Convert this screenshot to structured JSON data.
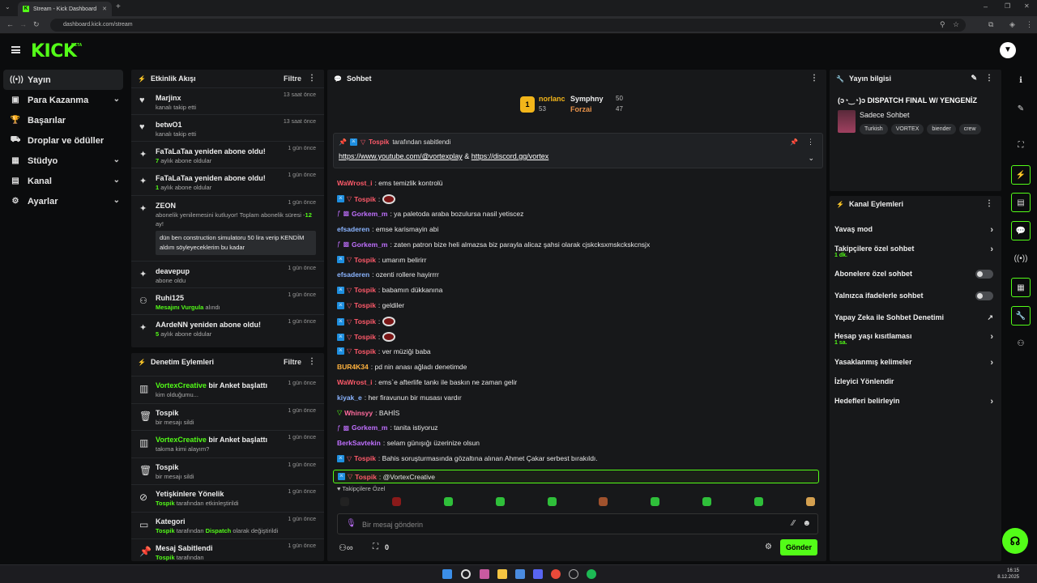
{
  "browser": {
    "tab_title": "Stream - Kick Dashboard",
    "url": "dashboard.kick.com/stream"
  },
  "brand": {
    "logo": "KICK",
    "beta": "BETA",
    "accent": "#53fc18"
  },
  "left_nav": [
    {
      "label": "Yayın",
      "icon": "broadcast-icon",
      "active": true
    },
    {
      "label": "Para Kazanma",
      "icon": "wallet-icon",
      "chevron": true
    },
    {
      "label": "Başarılar",
      "icon": "trophy-icon"
    },
    {
      "label": "Droplar ve ödüller",
      "icon": "gift-icon"
    },
    {
      "label": "Stüdyo",
      "icon": "studio-icon",
      "chevron": true
    },
    {
      "label": "Kanal",
      "icon": "channel-icon",
      "chevron": true
    },
    {
      "label": "Ayarlar",
      "icon": "gear-icon",
      "chevron": true
    }
  ],
  "activity": {
    "title": "Etkinlik Akışı",
    "filter": "Filtre",
    "events": [
      {
        "name": "Marjinx",
        "desc": "kanalı takip etti",
        "time": "13 saat önce"
      },
      {
        "name": "betwO1",
        "desc": "kanalı takip etti",
        "time": "13 saat önce"
      },
      {
        "name": "FaTaLaTaa yeniden abone oldu!",
        "num": "7",
        "desc": " aylık abone oldular",
        "time": "1 gün önce"
      },
      {
        "name": "FaTaLaTaa yeniden abone oldu!",
        "num": "1",
        "desc": " aylık abone oldular",
        "time": "1 gün önce"
      },
      {
        "name": "ZEON",
        "desc": "abonelik yenilemesini kutluyor! Toplam abonelik süresi -",
        "num": "12",
        "desc2": " ay!",
        "quote": "dün ben construction simulatoru 50 lira verip KENDİM aldım söyleyeceklerim bu kadar",
        "time": "1 gün önce"
      },
      {
        "name": "deavepup",
        "desc": "abone oldu",
        "time": "1 gün önce"
      },
      {
        "name": "Ruhi125",
        "num": "Mesajını Vurgula",
        "desc": " alındı",
        "time": "1 gün önce"
      },
      {
        "name": "AArdeNN yeniden abone oldu!",
        "num": "5",
        "desc": " aylık abone oldular",
        "time": "1 gün önce"
      }
    ]
  },
  "moderation": {
    "title": "Denetim Eylemleri",
    "filter": "Filtre",
    "events": [
      {
        "name": "VortexCreative",
        "rest": " bir Anket başlattı",
        "desc": "kim olduğumu...",
        "time": "1 gün önce"
      },
      {
        "name": "Tospik",
        "rest": "",
        "desc": "bir mesajı sildi",
        "time": "1 gün önce"
      },
      {
        "name": "VortexCreative",
        "rest": " bir Anket başlattı",
        "desc": "takıma kimi alayım?",
        "time": "1 gün önce"
      },
      {
        "name": "Tospik",
        "rest": "",
        "desc": "bir mesajı sildi",
        "time": "1 gün önce"
      },
      {
        "name": "Yetişkinlere Yönelik",
        "rest": "",
        "user": "Tospik",
        "desc": " tarafından etkinleştirildi",
        "time": "1 gün önce"
      },
      {
        "name": "Kategori",
        "rest": "",
        "user": "Tospik",
        "desc": " tarafından ",
        "extra": "Dispatch",
        "desc2": " olarak değiştirildi",
        "time": "1 gün önce"
      },
      {
        "name": "Mesaj Sabitlendi",
        "rest": "",
        "user": "Tospik",
        "desc": " tarafından",
        "time": "1 gün önce"
      }
    ]
  },
  "chat": {
    "title": "Sohbet",
    "leaderboard": [
      {
        "name": "norlanc",
        "value": "53",
        "rank": "1"
      },
      {
        "name": "Symphny",
        "value": "50"
      },
      {
        "name": "Forzai",
        "value": "47"
      }
    ],
    "pinned": {
      "user": "Tospik",
      "label": " tarafından sabitlendi",
      "link1": "https://www.youtube.com/@vortexplay",
      "amp": " & ",
      "link2": "https://discord.gg/vortex"
    },
    "messages": [
      {
        "user": "WaWrost_i",
        "color": "#ff5a6a",
        "text": ": ems temizlik kontrolü"
      },
      {
        "user": "Tospik",
        "color": "#ff5a6a",
        "text": ": ",
        "badges": "mod",
        "emote": true
      },
      {
        "user": "Gorkem_m",
        "color": "#c070ff",
        "text": ": ya paletoda araba bozulursa nasil yetiscez",
        "badges": "sub"
      },
      {
        "user": "efsaderen",
        "color": "#8ab4ff",
        "text": ": emse karismayin abi"
      },
      {
        "user": "Gorkem_m",
        "color": "#c070ff",
        "text": ": zaten patron bize heli almazsa biz parayla alicaz şahsi olarak cjskcksxmskckskcnsjx",
        "badges": "sub"
      },
      {
        "user": "Tospik",
        "color": "#ff5a6a",
        "text": ": umarım belirirr",
        "badges": "mod"
      },
      {
        "user": "efsaderen",
        "color": "#8ab4ff",
        "text": ": ozenti rollere hayirrrr"
      },
      {
        "user": "Tospik",
        "color": "#ff5a6a",
        "text": ": babamın dükkanına",
        "badges": "mod"
      },
      {
        "user": "Tospik",
        "color": "#ff5a6a",
        "text": ": geldiler",
        "badges": "mod"
      },
      {
        "user": "Tospik",
        "color": "#ff5a6a",
        "text": ": ",
        "badges": "mod",
        "emote": true
      },
      {
        "user": "Tospik",
        "color": "#ff5a6a",
        "text": ": ",
        "badges": "mod",
        "emote": true
      },
      {
        "user": "Tospik",
        "color": "#ff5a6a",
        "text": ": ver müziği baba",
        "badges": "mod"
      },
      {
        "user": "BUR4K34",
        "color": "#ffb23e",
        "text": ": pd nin anası ağladı denetimde"
      },
      {
        "user": "WaWrost_i",
        "color": "#ff5a6a",
        "text": ": ems`e afterlife tankı ile baskın ne zaman gelir"
      },
      {
        "user": "kiyak_e",
        "color": "#8ab4ff",
        "text": ": her firavunun bir musası vardır"
      },
      {
        "user": "Whinsyy",
        "color": "#ff6b9d",
        "text": ": BAHİS",
        "badges": "green"
      },
      {
        "user": "Gorkem_m",
        "color": "#c070ff",
        "text": ": tanita istiyoruz",
        "badges": "sub"
      },
      {
        "user": "BerkSavtekin",
        "color": "#c070ff",
        "text": ": selam günışığı üzerinize olsun"
      },
      {
        "user": "Tospik",
        "color": "#ff5a6a",
        "text": ": Bahis soruşturmasında gözaltına alınan Ahmet Çakar serbest bırakıldı.",
        "badges": "mod"
      },
      {
        "user": "Tospik",
        "color": "#ff5a6a",
        "text": ": @VortexCreative",
        "badges": "mod",
        "highlight": true
      }
    ],
    "followers_only": "Takipçilere Özel",
    "input_placeholder": "Bir mesaj gönderin",
    "points": "0",
    "send": "Gönder"
  },
  "stream_info": {
    "title": "Yayın bilgisi",
    "stream_title": "(ɔ◔‿◔)ɔ DISPATCH FINAL W/ YENGENİZ",
    "category": "Sadece Sohbet",
    "tags": [
      "Turkish",
      "VORTEX",
      "biender",
      "crew"
    ]
  },
  "channel_actions": {
    "title": "Kanal Eylemleri",
    "items": [
      {
        "label": "Yavaş mod",
        "type": "arrow"
      },
      {
        "label": "Takipçilere özel sohbet",
        "sub": "1 dk.",
        "type": "arrow"
      },
      {
        "label": "Abonelere özel sohbet",
        "type": "toggle"
      },
      {
        "label": "Yalnızca ifadelerle sohbet",
        "type": "toggle"
      },
      {
        "label": "Yapay Zeka ile Sohbet Denetimi",
        "type": "external"
      },
      {
        "label": "Hesap yaşı kısıtlaması",
        "sub": "1 sa.",
        "type": "arrow"
      },
      {
        "label": "Yasaklanmış kelimeler",
        "type": "arrow"
      },
      {
        "label": "İzleyici Yönlendir",
        "type": "none"
      },
      {
        "label": "Hedefleri belirleyin",
        "type": "arrow"
      }
    ]
  },
  "taskbar": {
    "time": "16:15",
    "date": "8.12.2025"
  }
}
